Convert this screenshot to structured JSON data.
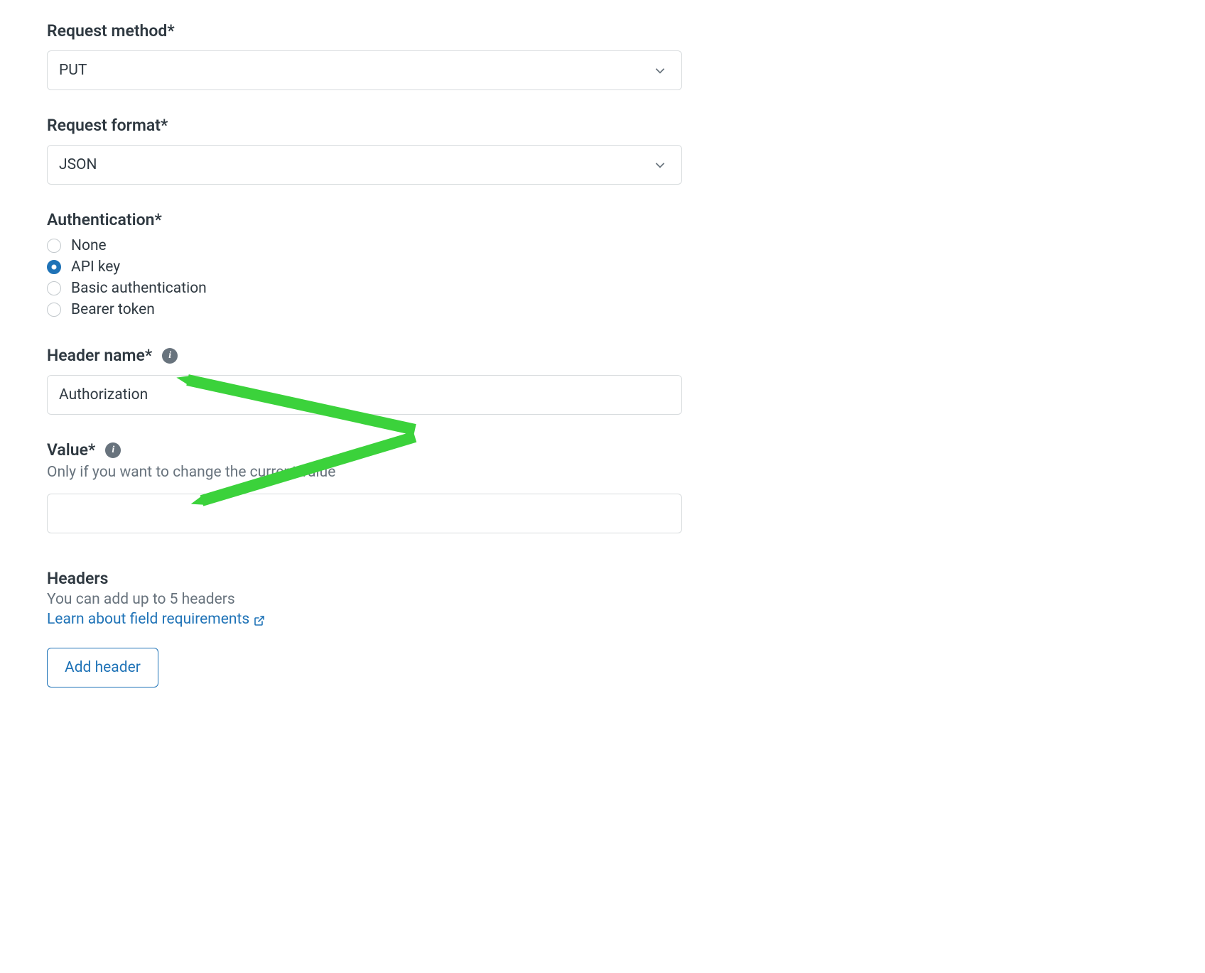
{
  "requestMethod": {
    "label": "Request method*",
    "value": "PUT"
  },
  "requestFormat": {
    "label": "Request format*",
    "value": "JSON"
  },
  "authentication": {
    "label": "Authentication*",
    "options": [
      {
        "label": "None",
        "checked": false
      },
      {
        "label": "API key",
        "checked": true
      },
      {
        "label": "Basic authentication",
        "checked": false
      },
      {
        "label": "Bearer token",
        "checked": false
      }
    ]
  },
  "headerName": {
    "label": "Header name*",
    "value": "Authorization"
  },
  "value": {
    "label": "Value*",
    "help": "Only if you want to change the current value",
    "value": ""
  },
  "headers": {
    "title": "Headers",
    "subtitle": "You can add up to 5 headers",
    "link": "Learn about field requirements",
    "button": "Add header"
  }
}
